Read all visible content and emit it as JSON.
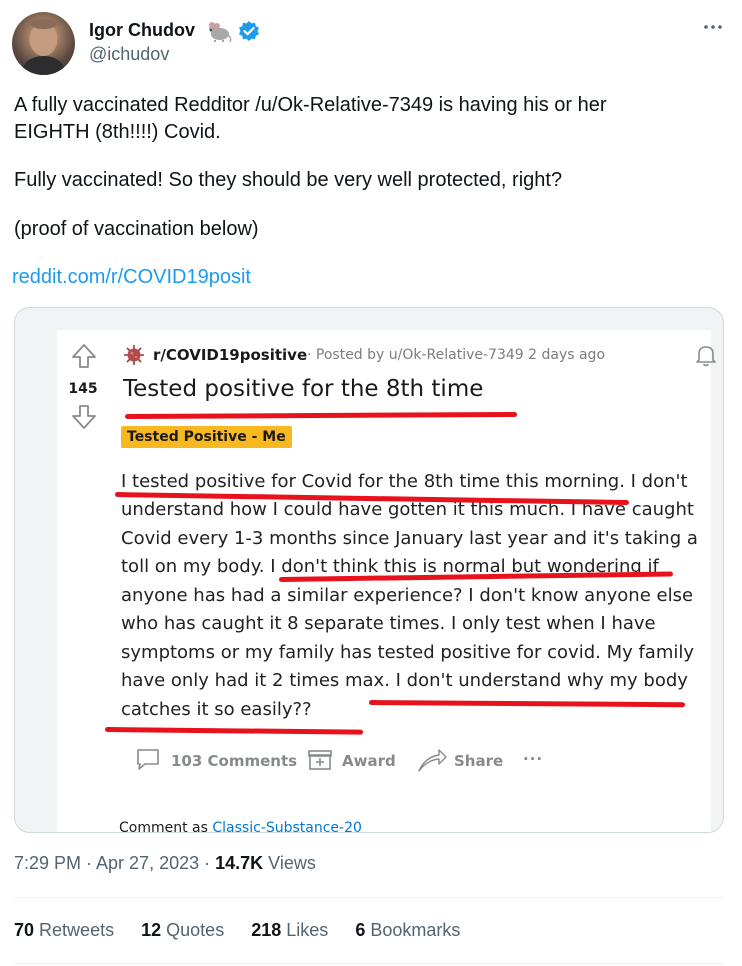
{
  "author": {
    "name": "Igor Chudov",
    "handle": "@ichudov",
    "badge_icon": "rat-emoji",
    "verified_icon": "verified-badge-icon",
    "verified_color": "#1d9bf0"
  },
  "tweet": {
    "lines": [
      "A fully vaccinated Redditor /u/Ok-Relative-7349 is having his or her",
      "EIGHTH (8th!!!!) Covid.",
      "Fully vaccinated! So they should be very well protected, right?",
      "(proof of vaccination below)"
    ],
    "link": "reddit.com/r/COVID19posit"
  },
  "reddit": {
    "votes": "145",
    "subreddit": "r/COVID19positive",
    "posted_by": "· Posted by u/Ok-Relative-7349 2 days ago",
    "title": "Tested positive for the 8th time",
    "flair": "Tested Positive - Me",
    "flair_color": "#f8b822",
    "body_lines": [
      "I tested positive for Covid for the 8th time this morning. I don't",
      "understand how I could have gotten it this much. I have caught",
      "Covid every 1-3 months since January last year and it's taking a",
      "toll on my body. I don't think this is normal but wondering if",
      "anyone has had a similar experience? I don't know anyone else",
      "who has caught it 8 separate times. I only test when I have",
      "symptoms or my family has tested positive for covid. My family",
      "have only had it 2 times max. I don't understand why my body",
      "catches it so easily??"
    ],
    "actions": {
      "comments": "103 Comments",
      "award": "Award",
      "share": "Share",
      "more": "···"
    },
    "comment_as_prefix": "Comment as ",
    "comment_as_user": "Classic-Substance-20",
    "underline_color": "#e8121d"
  },
  "meta": {
    "time": "7:29 PM · Apr 27, 2023 · ",
    "views_count": "14.7K",
    "views_label": " Views"
  },
  "stats": {
    "retweets_count": "70",
    "retweets_label": "Retweets",
    "quotes_count": "12",
    "quotes_label": "Quotes",
    "likes_count": "218",
    "likes_label": "Likes",
    "bookmarks_count": "6",
    "bookmarks_label": "Bookmarks"
  }
}
